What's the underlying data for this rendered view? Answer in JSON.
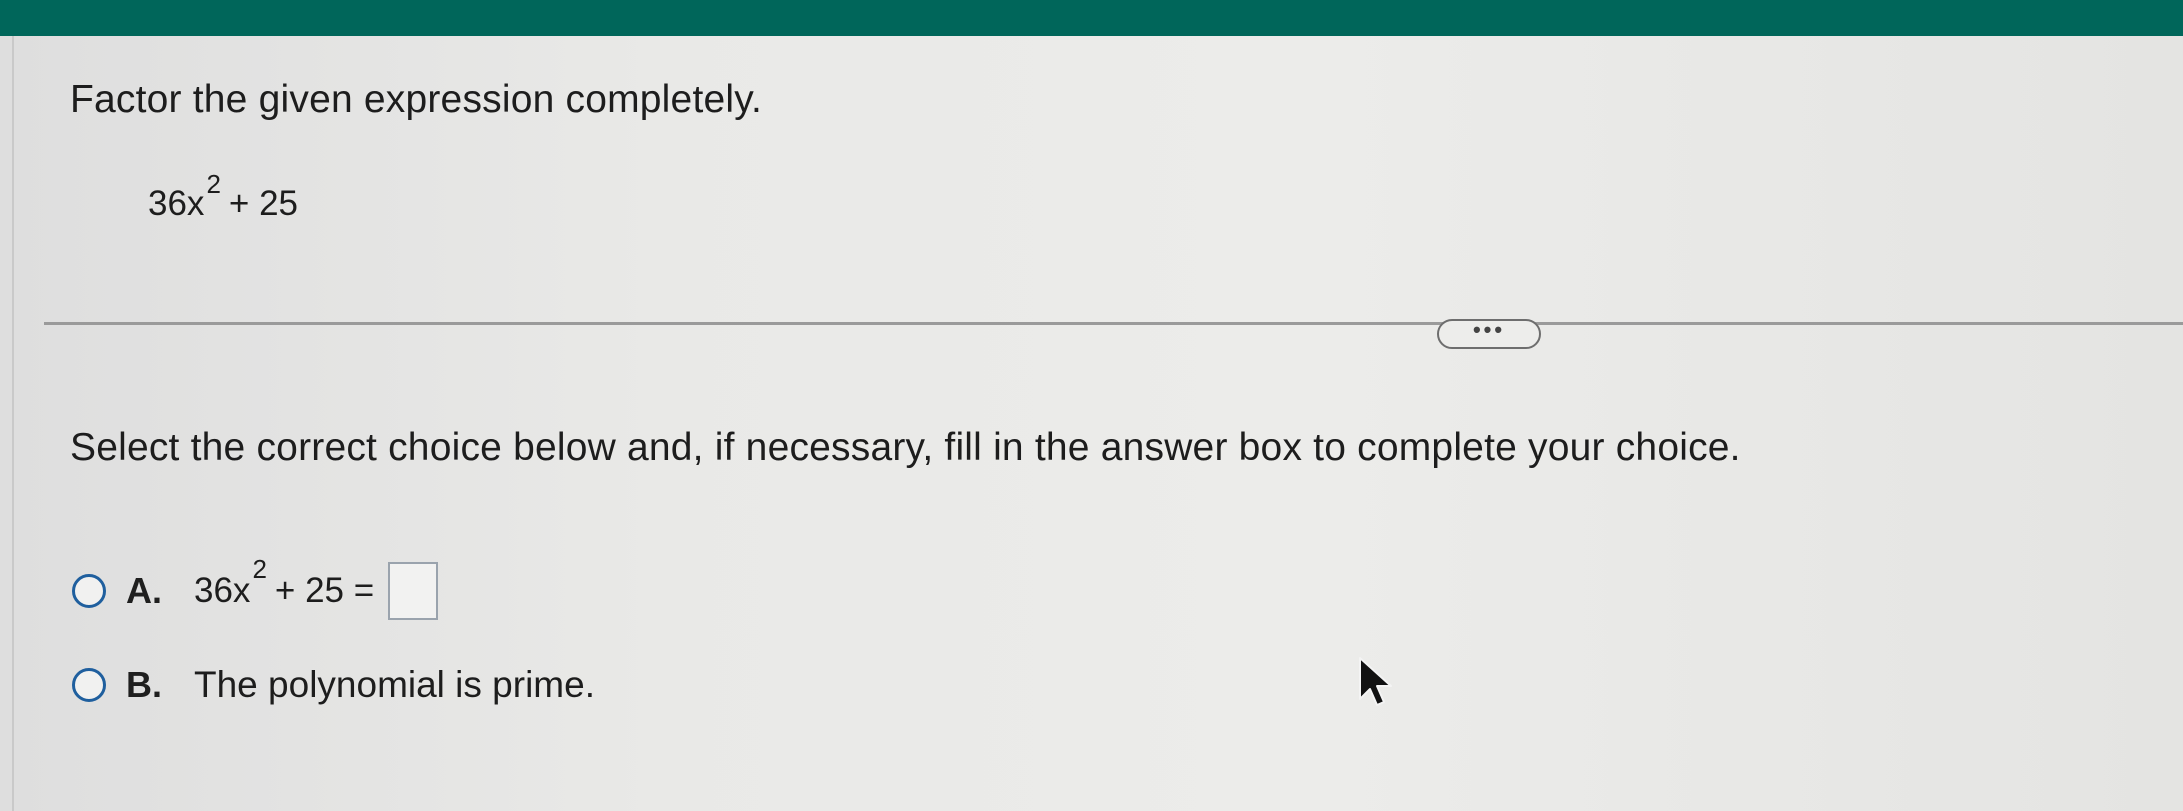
{
  "colors": {
    "top_bar": "#00665a",
    "radio_border": "#1f5f9e"
  },
  "question": {
    "prompt": "Factor the given expression completely.",
    "expression": {
      "coefficient": "36x",
      "exponent": "2",
      "rest": "+ 25"
    }
  },
  "more_button": {
    "label": "•••"
  },
  "instruction": "Select the correct choice below and, if necessary, fill in the answer box to complete your choice.",
  "choices": [
    {
      "letter": "A.",
      "expression": {
        "coefficient": "36x",
        "exponent": "2",
        "rest": "+ 25 ="
      },
      "answer_value": ""
    },
    {
      "letter": "B.",
      "text": "The polynomial is prime."
    }
  ],
  "icons": {
    "cursor": "mouse-pointer-icon"
  }
}
